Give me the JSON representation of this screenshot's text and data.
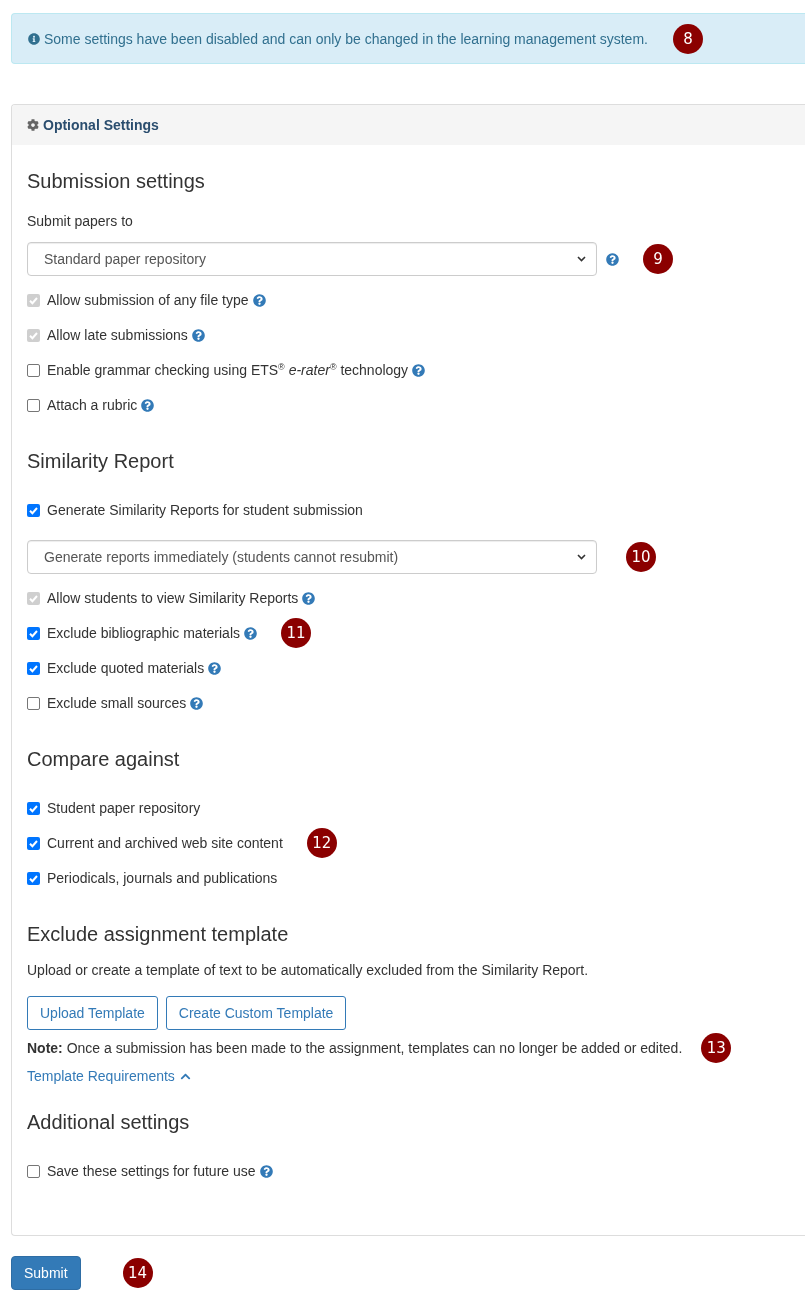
{
  "alert": {
    "text": "Some settings have been disabled and can only be changed in the learning management system.",
    "callout": "8"
  },
  "panel": {
    "title": "Optional Settings",
    "sections": [
      {
        "heading": "Submission settings",
        "items": [
          {
            "kind": "label",
            "text": "Submit papers to"
          },
          {
            "kind": "select",
            "value": "Standard paper repository",
            "help": true,
            "callout": "9"
          },
          {
            "kind": "checkbox",
            "label": "Allow submission of any file type",
            "checked": true,
            "disabled": true,
            "help": true
          },
          {
            "kind": "checkbox",
            "label": "Allow late submissions",
            "checked": true,
            "disabled": true,
            "help": true
          },
          {
            "kind": "checkbox",
            "label": "Enable grammar checking using ETS$^{®}$ *e-rater*$^{®}$ technology",
            "checked": false,
            "disabled": false,
            "help": true
          },
          {
            "kind": "checkbox",
            "label": "Attach a rubric",
            "checked": false,
            "disabled": false,
            "help": true
          }
        ]
      },
      {
        "heading": "Similarity Report",
        "items": [
          {
            "kind": "checkbox",
            "label": "Generate Similarity Reports for student submission",
            "checked": true,
            "disabled": false
          },
          {
            "kind": "select",
            "value": "Generate reports immediately (students cannot resubmit)",
            "callout": "10"
          },
          {
            "kind": "checkbox",
            "label": "Allow students to view Similarity Reports",
            "checked": true,
            "disabled": true,
            "help": true
          },
          {
            "kind": "checkbox",
            "label": "Exclude bibliographic materials",
            "checked": true,
            "disabled": false,
            "help": true,
            "callout": "11"
          },
          {
            "kind": "checkbox",
            "label": "Exclude quoted materials",
            "checked": true,
            "disabled": false,
            "help": true
          },
          {
            "kind": "checkbox",
            "label": "Exclude small sources",
            "checked": false,
            "disabled": false,
            "help": true
          }
        ]
      },
      {
        "heading": "Compare against",
        "items": [
          {
            "kind": "checkbox",
            "label": "Student paper repository",
            "checked": true,
            "disabled": false
          },
          {
            "kind": "checkbox",
            "label": "Current and archived web site content",
            "checked": true,
            "disabled": false,
            "callout": "12"
          },
          {
            "kind": "checkbox",
            "label": "Periodicals, journals and publications",
            "checked": true,
            "disabled": false
          }
        ]
      },
      {
        "heading": "Exclude assignment template",
        "items": [
          {
            "kind": "paragraph",
            "text": "Upload or create a template of text to be automatically excluded from the Similarity Report."
          },
          {
            "kind": "buttons",
            "buttons": [
              "Upload Template",
              "Create Custom Template"
            ]
          },
          {
            "kind": "paragraph",
            "text": "**Note:** Once a submission has been made to the assignment, templates can no longer be added or edited.",
            "callout": "13"
          },
          {
            "kind": "link",
            "text": "Template Requirements",
            "expanded": true
          }
        ]
      },
      {
        "heading": "Additional settings",
        "items": [
          {
            "kind": "checkbox",
            "label": "Save these settings for future use",
            "checked": false,
            "disabled": false,
            "help": true
          }
        ]
      }
    ]
  },
  "submit": {
    "label": "Submit",
    "callout": "14"
  }
}
